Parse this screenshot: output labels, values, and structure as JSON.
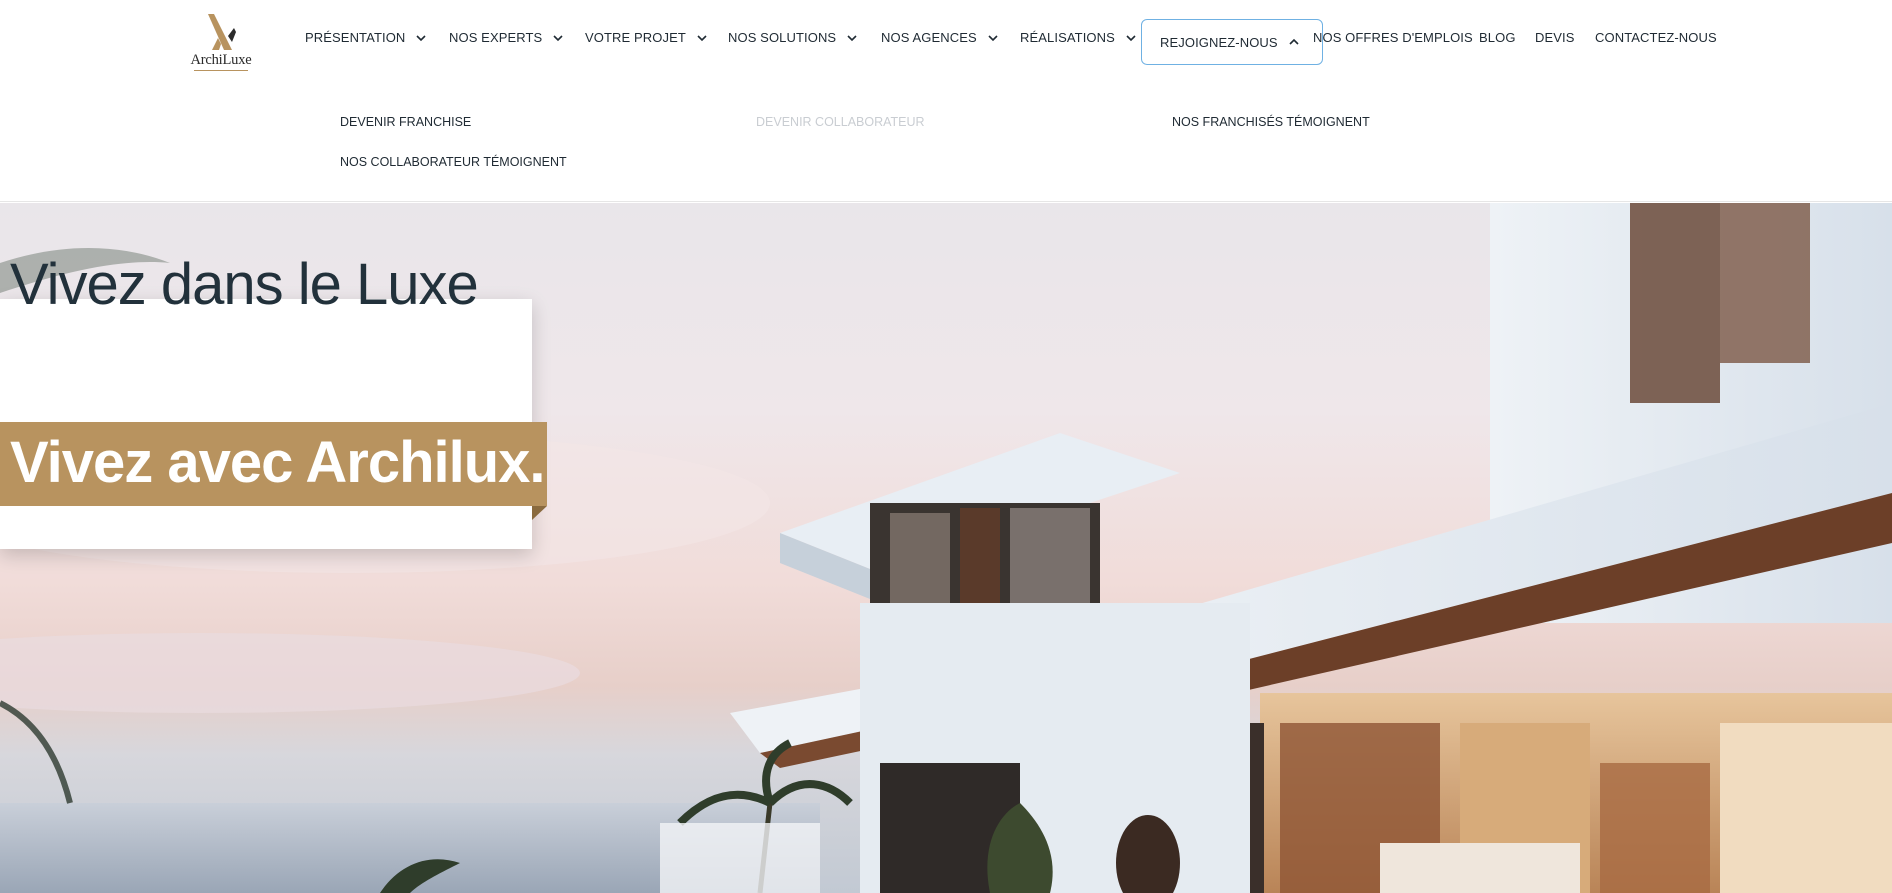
{
  "brand": {
    "name": "ArchiLuxe"
  },
  "nav": {
    "items": [
      {
        "label": "PRÉSENTATION"
      },
      {
        "label": "NOS EXPERTS"
      },
      {
        "label": "VOTRE PROJET"
      },
      {
        "label": "NOS SOLUTIONS"
      },
      {
        "label": "NOS AGENCES"
      },
      {
        "label": "RÉALISATIONS"
      },
      {
        "label": "REJOIGNEZ-NOUS"
      },
      {
        "label": "NOS OFFRES D'EMPLOIS"
      },
      {
        "label": "BLOG"
      },
      {
        "label": "DEVIS"
      },
      {
        "label": "CONTACTEZ-NOUS"
      }
    ],
    "dropdown": [
      {
        "label": "DEVENIR FRANCHISE"
      },
      {
        "label": "DEVENIR COLLABORATEUR"
      },
      {
        "label": "NOS FRANCHISÉS TÉMOIGNENT"
      },
      {
        "label": "NOS COLLABORATEUR TÉMOIGNENT"
      }
    ]
  },
  "hero": {
    "line1": "Vivez dans le Luxe",
    "line2": "Vivez avec Archilux."
  },
  "colors": {
    "accent": "#b8935f",
    "text": "#22313b",
    "focus": "#6fb1e3"
  }
}
